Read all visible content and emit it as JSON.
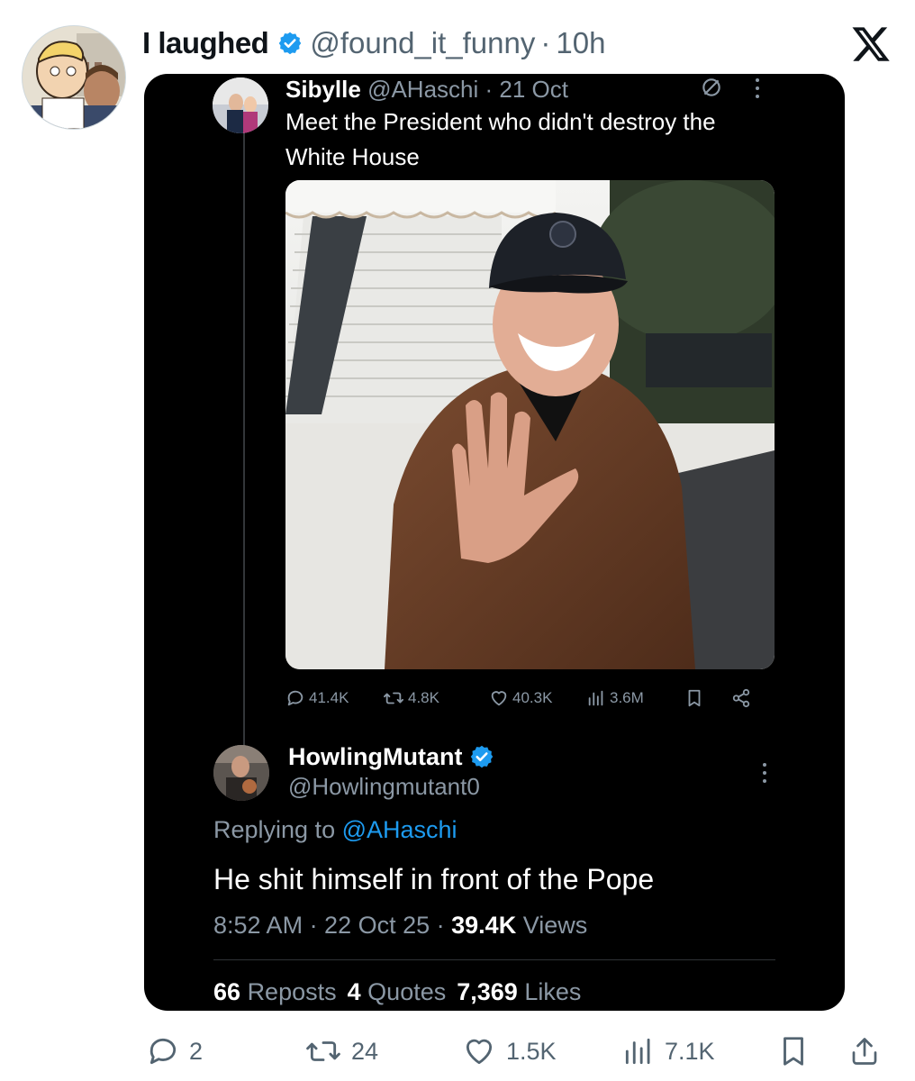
{
  "post": {
    "author_name": "I laughed",
    "author_handle": "@found_it_funny",
    "separator": "·",
    "time": "10h"
  },
  "quoted": {
    "author_name": "Sibylle",
    "author_handle": "@AHaschi",
    "date": "21 Oct",
    "text": "Meet the President who didn't destroy the White House",
    "stats": {
      "replies": "41.4K",
      "reposts": "4.8K",
      "likes": "40.3K",
      "views": "3.6M"
    }
  },
  "reply": {
    "author_name": "HowlingMutant",
    "author_handle": "@Howlingmutant0",
    "replying_prefix": "Replying to",
    "replying_handle": "@AHaschi",
    "text": "He shit himself in front of the Pope",
    "timestamp": "8:52 AM · 22 Oct 25 ·",
    "views_count": "39.4K",
    "views_label": "Views",
    "reposts_count": "66",
    "reposts_label": "Reposts",
    "quotes_count": "4",
    "quotes_label": "Quotes",
    "likes_count": "7,369",
    "likes_label": "Likes"
  },
  "actions": {
    "replies": "2",
    "reposts": "24",
    "likes": "1.5K",
    "views": "7.1K"
  },
  "colors": {
    "verified": "#1d9bf0",
    "muted": "#536471",
    "dark_muted": "#8b98a5",
    "card_bg": "#000000",
    "link": "#1d9bf0"
  },
  "icons": [
    "verified-badge-icon",
    "x-logo-icon",
    "mute-icon",
    "more-icon",
    "reply-icon",
    "repost-icon",
    "like-icon",
    "views-icon",
    "bookmark-icon",
    "share-icon"
  ]
}
